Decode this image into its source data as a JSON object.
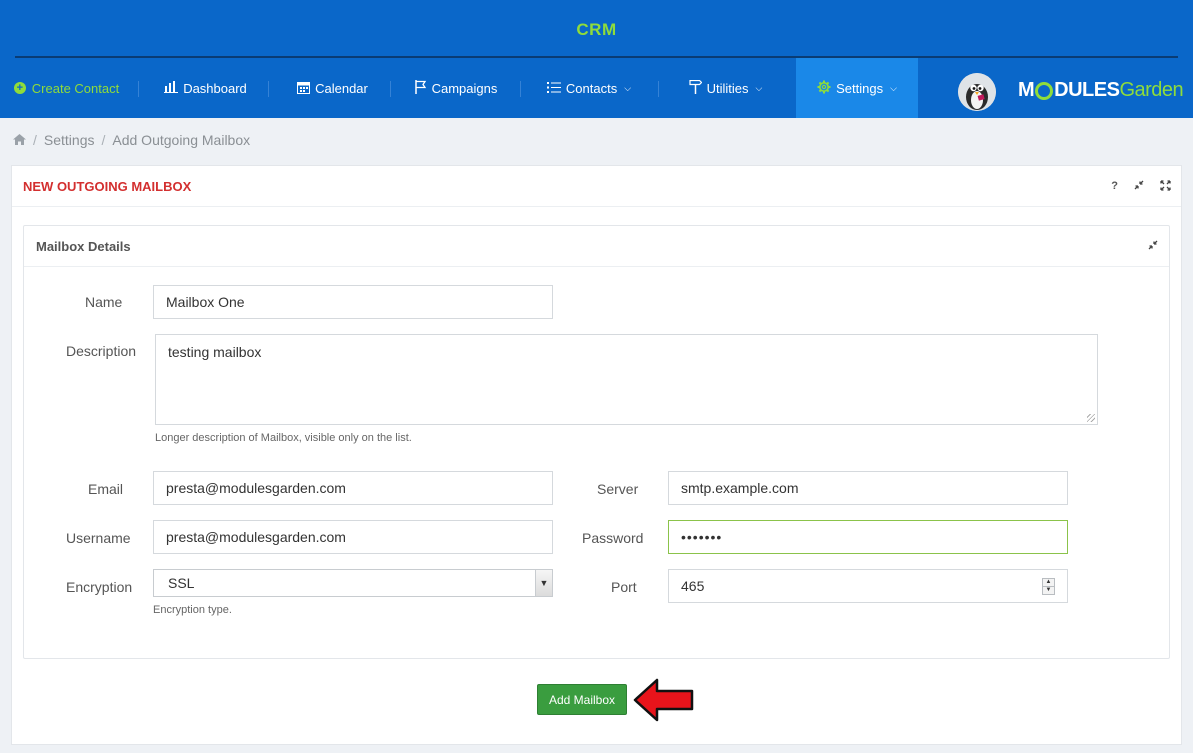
{
  "app": {
    "title": "CRM"
  },
  "nav": {
    "create": "Create Contact",
    "dashboard": "Dashboard",
    "calendar": "Calendar",
    "campaigns": "Campaigns",
    "contacts": "Contacts",
    "utilities": "Utilities",
    "settings": "Settings"
  },
  "logo": {
    "part1": "M",
    "part2": "DULES",
    "part3": "Garden"
  },
  "breadcrumb": {
    "settings": "Settings",
    "current": "Add Outgoing Mailbox"
  },
  "panel": {
    "title": "NEW OUTGOING MAILBOX",
    "help": "?"
  },
  "section": {
    "title": "Mailbox Details"
  },
  "form": {
    "name_label": "Name",
    "name_value": "Mailbox One",
    "description_label": "Description",
    "description_value": "testing mailbox",
    "description_help": "Longer description of Mailbox, visible only on the list.",
    "email_label": "Email",
    "email_value": "presta@modulesgarden.com",
    "server_label": "Server",
    "server_value": "smtp.example.com",
    "username_label": "Username",
    "username_value": "presta@modulesgarden.com",
    "password_label": "Password",
    "password_value": "•••••••",
    "encryption_label": "Encryption",
    "encryption_value": "SSL",
    "encryption_help": "Encryption type.",
    "port_label": "Port",
    "port_value": "465"
  },
  "actions": {
    "submit": "Add Mailbox"
  },
  "colors": {
    "header": "#0a67c9",
    "accent": "#8fdc3b",
    "title_red": "#d32f2f",
    "button_green": "#3a9d3f",
    "arrow_red": "#e8141b"
  }
}
